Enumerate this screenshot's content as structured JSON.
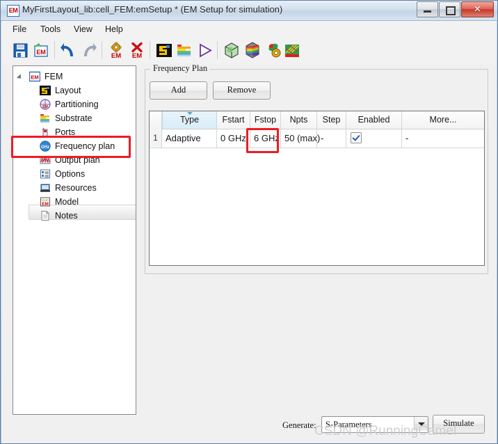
{
  "window": {
    "app_icon_text": "EM",
    "title": "MyFirstLayout_lib:cell_FEM:emSetup * (EM Setup for simulation)",
    "minimize_label": "",
    "maximize_label": "",
    "close_label": "✕"
  },
  "menubar": {
    "items": [
      {
        "label": "File"
      },
      {
        "label": "Tools"
      },
      {
        "label": "View"
      },
      {
        "label": "Help"
      }
    ]
  },
  "toolbar": {
    "items": [
      {
        "name": "save-icon",
        "title": "Save"
      },
      {
        "name": "save-em-setup-icon",
        "title": "Save EM Setup"
      },
      {
        "name": "undo-icon",
        "title": "Undo"
      },
      {
        "name": "redo-icon",
        "title": "Redo"
      },
      {
        "name": "em-settings-icon",
        "title": "EM Settings"
      },
      {
        "name": "em-delete-icon",
        "title": "Delete EM Setup"
      },
      {
        "name": "layout-icon",
        "title": "Layout"
      },
      {
        "name": "substrate-icon",
        "title": "Substrate"
      },
      {
        "name": "simulate-icon",
        "title": "Simulate"
      },
      {
        "name": "mesh-3d-icon",
        "title": "3D Mesh"
      },
      {
        "name": "em-field-cube-icon",
        "title": "EM Field Visualization"
      },
      {
        "name": "em-options-icon",
        "title": "EM Options"
      },
      {
        "name": "em-results-icon",
        "title": "EM Results"
      }
    ]
  },
  "sidebar": {
    "items": [
      {
        "label": "FEM",
        "icon": "em-root-icon",
        "level": 0,
        "selected": false
      },
      {
        "label": "Layout",
        "icon": "layout-icon",
        "level": 1,
        "selected": false
      },
      {
        "label": "Partitioning",
        "icon": "partitioning-icon",
        "level": 1,
        "selected": false
      },
      {
        "label": "Substrate",
        "icon": "substrate-icon",
        "level": 1,
        "selected": false
      },
      {
        "label": "Ports",
        "icon": "ports-icon",
        "level": 1,
        "selected": false
      },
      {
        "label": "Frequency plan",
        "icon": "ghz-icon",
        "level": 1,
        "selected": true
      },
      {
        "label": "Output plan",
        "icon": "output-plan-icon",
        "level": 1,
        "selected": false
      },
      {
        "label": "Options",
        "icon": "options-icon",
        "level": 1,
        "selected": false
      },
      {
        "label": "Resources",
        "icon": "resources-icon",
        "level": 1,
        "selected": false
      },
      {
        "label": "Model",
        "icon": "model-icon",
        "level": 1,
        "selected": false
      },
      {
        "label": "Notes",
        "icon": "notes-icon",
        "level": 1,
        "selected": false
      }
    ]
  },
  "main": {
    "groupbox_title": "Frequency Plan",
    "add_label": "Add",
    "remove_label": "Remove",
    "table": {
      "columns": [
        "",
        "Type",
        "Fstart",
        "Fstop",
        "Npts",
        "Step",
        "Enabled",
        "More..."
      ],
      "sorted_column": "Type",
      "rows": [
        {
          "num": "1",
          "type": "Adaptive",
          "fstart": "0 GHz",
          "fstop": "6 GHz",
          "npts": "50 (max)",
          "step": "-",
          "enabled": true,
          "more": "-"
        }
      ]
    }
  },
  "footer": {
    "generate_label": "Generate:",
    "generate_value": "S-Parameters",
    "simulate_label": "Simulate"
  },
  "annotations": {
    "highlight_color": "#ed1c24",
    "watermark": "CSDN @RunningCamel"
  }
}
